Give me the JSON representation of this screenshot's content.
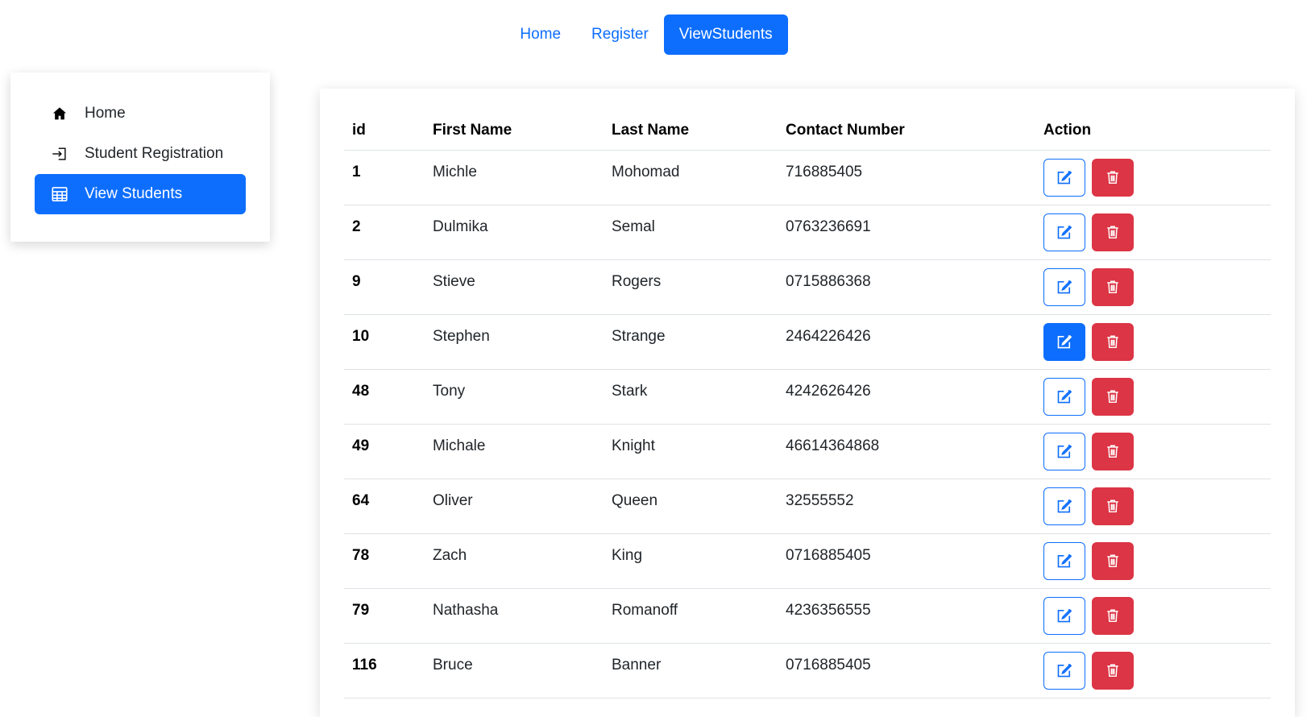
{
  "topnav": {
    "items": [
      {
        "label": "Home",
        "active": false
      },
      {
        "label": "Register",
        "active": false
      },
      {
        "label": "ViewStudents",
        "active": true
      }
    ]
  },
  "sidebar": {
    "items": [
      {
        "label": "Home",
        "icon": "home-icon",
        "active": false
      },
      {
        "label": "Student Registration",
        "icon": "sign-in-icon",
        "active": false
      },
      {
        "label": "View Students",
        "icon": "table-icon",
        "active": true
      }
    ]
  },
  "table": {
    "headers": [
      "id",
      "First Name",
      "Last Name",
      "Contact Number",
      "Action"
    ],
    "rows": [
      {
        "id": "1",
        "first": "Michle",
        "last": "Mohomad",
        "contact": "716885405"
      },
      {
        "id": "2",
        "first": "Dulmika",
        "last": "Semal",
        "contact": "0763236691"
      },
      {
        "id": "9",
        "first": "Stieve",
        "last": "Rogers",
        "contact": "0715886368"
      },
      {
        "id": "10",
        "first": "Stephen",
        "last": "Strange",
        "contact": "2464226426"
      },
      {
        "id": "48",
        "first": "Tony",
        "last": "Stark",
        "contact": "4242626426"
      },
      {
        "id": "49",
        "first": "Michale",
        "last": "Knight",
        "contact": "46614364868"
      },
      {
        "id": "64",
        "first": "Oliver",
        "last": "Queen",
        "contact": "32555552"
      },
      {
        "id": "78",
        "first": "Zach",
        "last": "King",
        "contact": "0716885405"
      },
      {
        "id": "79",
        "first": "Nathasha",
        "last": "Romanoff",
        "contact": "4236356555"
      },
      {
        "id": "116",
        "first": "Bruce",
        "last": "Banner",
        "contact": "0716885405"
      }
    ]
  },
  "colors": {
    "primary": "#0d6efd",
    "danger": "#dc3545"
  },
  "icons": {
    "edit": "edit-icon",
    "delete": "trash-icon"
  }
}
